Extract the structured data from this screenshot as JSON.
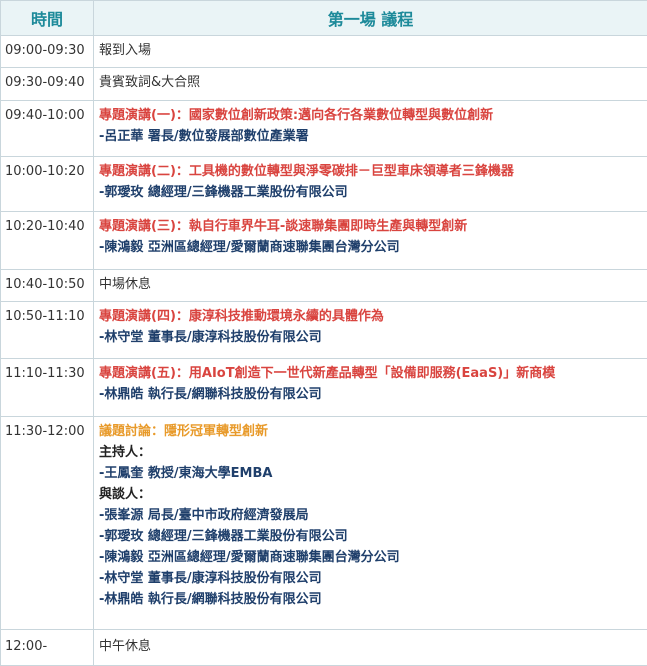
{
  "header": {
    "time": "時間",
    "program": "第一場 議程"
  },
  "rows": [
    {
      "time": "09:00-09:30",
      "text": "報到入場"
    },
    {
      "time": "09:30-09:40",
      "text": "貴賓致詞&大合照"
    },
    {
      "time": "09:40-10:00",
      "title": "專題演講(一)：國家數位創新政策:邁向各行各業數位轉型與數位創新",
      "speaker": "-呂正華 署長/數位發展部數位產業署"
    },
    {
      "time": "10:00-10:20",
      "title": "專題演講(二)：工具機的數位轉型與淨零碳排－巨型車床領導者三鋒機器",
      "speaker": "-郭璦玫 總經理/三鋒機器工業股份有限公司"
    },
    {
      "time": "10:20-10:40",
      "title": "專題演講(三)：執自行車界牛耳-談速聯集團即時生產與轉型創新",
      "speaker": "-陳鴻毅 亞洲區總經理/愛爾蘭商速聯集團台灣分公司"
    },
    {
      "time": "10:40-10:50",
      "text": "中場休息"
    },
    {
      "time": "10:50-11:10",
      "title": "專題演講(四)：康淳科技推動環境永續的具體作為",
      "speaker": "-林守堂 董事長/康淳科技股份有限公司"
    },
    {
      "time": "11:10-11:30",
      "title": "專題演講(五)：用AIoT創造下一世代新產品轉型「設備即服務(EaaS)」新商模",
      "speaker": "-林鼎皓 執行長/網聯科技股份有限公司"
    },
    {
      "time": "11:30-12:00",
      "panel_title": "議題討論：隱形冠軍轉型創新",
      "moderator_label": "主持人：",
      "moderator": "-王鳳奎 教授/東海大學EMBA",
      "panelists_label": "與談人：",
      "panelists": [
        "-張峯源 局長/臺中市政府經濟發展局",
        "-郭璦玫 總經理/三鋒機器工業股份有限公司",
        "-陳鴻毅 亞洲區總經理/愛爾蘭商速聯集團台灣分公司",
        "-林守堂 董事長/康淳科技股份有限公司",
        "-林鼎皓 執行長/網聯科技股份有限公司"
      ]
    },
    {
      "time": "12:00-",
      "text": "中午休息"
    }
  ]
}
